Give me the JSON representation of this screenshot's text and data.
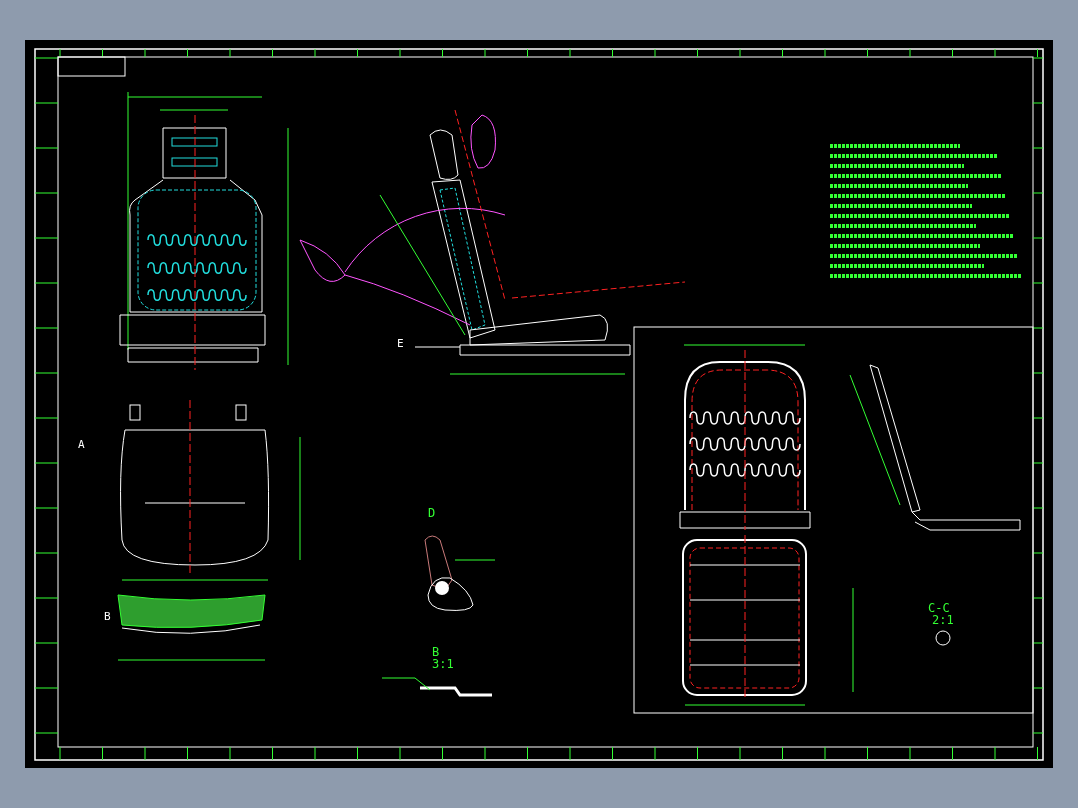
{
  "view_labels": [
    {
      "text": "E",
      "kind": "arrow"
    },
    {
      "text": "A",
      "kind": "arrow"
    },
    {
      "text": "B",
      "kind": "arrow"
    },
    {
      "text": "D",
      "kind": "title"
    },
    {
      "text": "B",
      "kind": "title"
    },
    {
      "text": "3:1",
      "kind": "scale"
    },
    {
      "text": "C-C",
      "kind": "title"
    },
    {
      "text": "2:1",
      "kind": "scale"
    }
  ]
}
